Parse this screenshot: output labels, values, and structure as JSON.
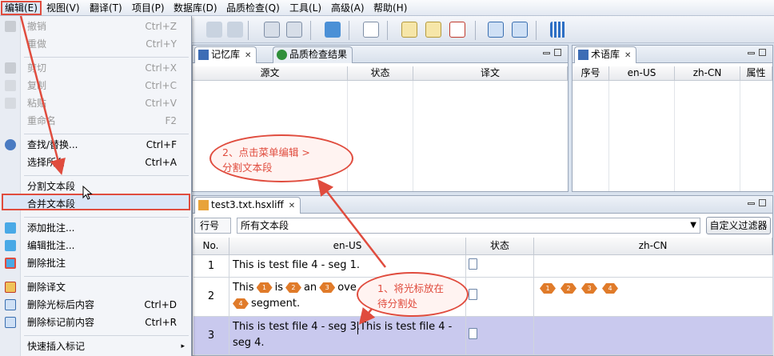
{
  "menubar": [
    "编辑(E)",
    "视图(V)",
    "翻译(T)",
    "项目(P)",
    "数据库(D)",
    "品质检查(Q)",
    "工具(L)",
    "高级(A)",
    "帮助(H)"
  ],
  "context_menu": {
    "items": [
      {
        "label": "撤销",
        "shortcut": "Ctrl+Z",
        "disabled": true
      },
      {
        "label": "重做",
        "shortcut": "Ctrl+Y",
        "disabled": true
      },
      {
        "label": "剪切",
        "shortcut": "Ctrl+X",
        "disabled": true
      },
      {
        "label": "复制",
        "shortcut": "Ctrl+C",
        "disabled": true
      },
      {
        "label": "粘贴",
        "shortcut": "Ctrl+V",
        "disabled": true
      },
      {
        "label": "重命名",
        "shortcut": "F2",
        "disabled": true
      },
      {
        "label": "查找/替换...",
        "shortcut": "Ctrl+F"
      },
      {
        "label": "选择所有",
        "shortcut": "Ctrl+A"
      },
      {
        "label": "分割文本段",
        "shortcut": ""
      },
      {
        "label": "合并文本段",
        "shortcut": ""
      },
      {
        "label": "添加批注...",
        "shortcut": ""
      },
      {
        "label": "编辑批注...",
        "shortcut": ""
      },
      {
        "label": "删除批注",
        "shortcut": ""
      },
      {
        "label": "删除译文",
        "shortcut": ""
      },
      {
        "label": "删除光标后内容",
        "shortcut": "Ctrl+D"
      },
      {
        "label": "删除标记前内容",
        "shortcut": "Ctrl+R"
      },
      {
        "label": "快速插入标记",
        "shortcut": "▸"
      }
    ]
  },
  "tm_panel": {
    "tabs": [
      "记忆库",
      "品质检查结果"
    ],
    "columns": [
      "源文",
      "状态",
      "译文"
    ]
  },
  "term_panel": {
    "tab": "术语库",
    "columns": [
      "序号",
      "en-US",
      "zh-CN",
      "属性"
    ]
  },
  "editor": {
    "tab": "test3.txt.hsxliff",
    "filter_label": "行号",
    "filter_value": "所有文本段",
    "filter_button": "自定义过滤器",
    "columns": [
      "No.",
      "en-US",
      "状态",
      "zh-CN"
    ],
    "rows": [
      {
        "no": "1",
        "src_line1": "This is test file 4 - seg 1.",
        "src_line2": "",
        "target": ""
      },
      {
        "no": "2",
        "src_line1": "This",
        "src_line2": "segment.",
        "target": "tags"
      },
      {
        "no": "3",
        "src_line1": "This is test file 4 - seg 3.This is test file 4 -",
        "src_line2": "seg 4.",
        "target": ""
      }
    ],
    "row2_words": [
      "is",
      "an",
      "ove"
    ],
    "tag_numbers": [
      "1",
      "2",
      "3",
      "4"
    ]
  },
  "callouts": {
    "menu": "2、点击菜单编辑 >\n分割文本段",
    "cursor": "1、将光标放在\n待分割处"
  },
  "colors": {
    "accent": "#e04c3e",
    "selected_row": "#c9c9ee",
    "tag": "#e07b2a"
  }
}
